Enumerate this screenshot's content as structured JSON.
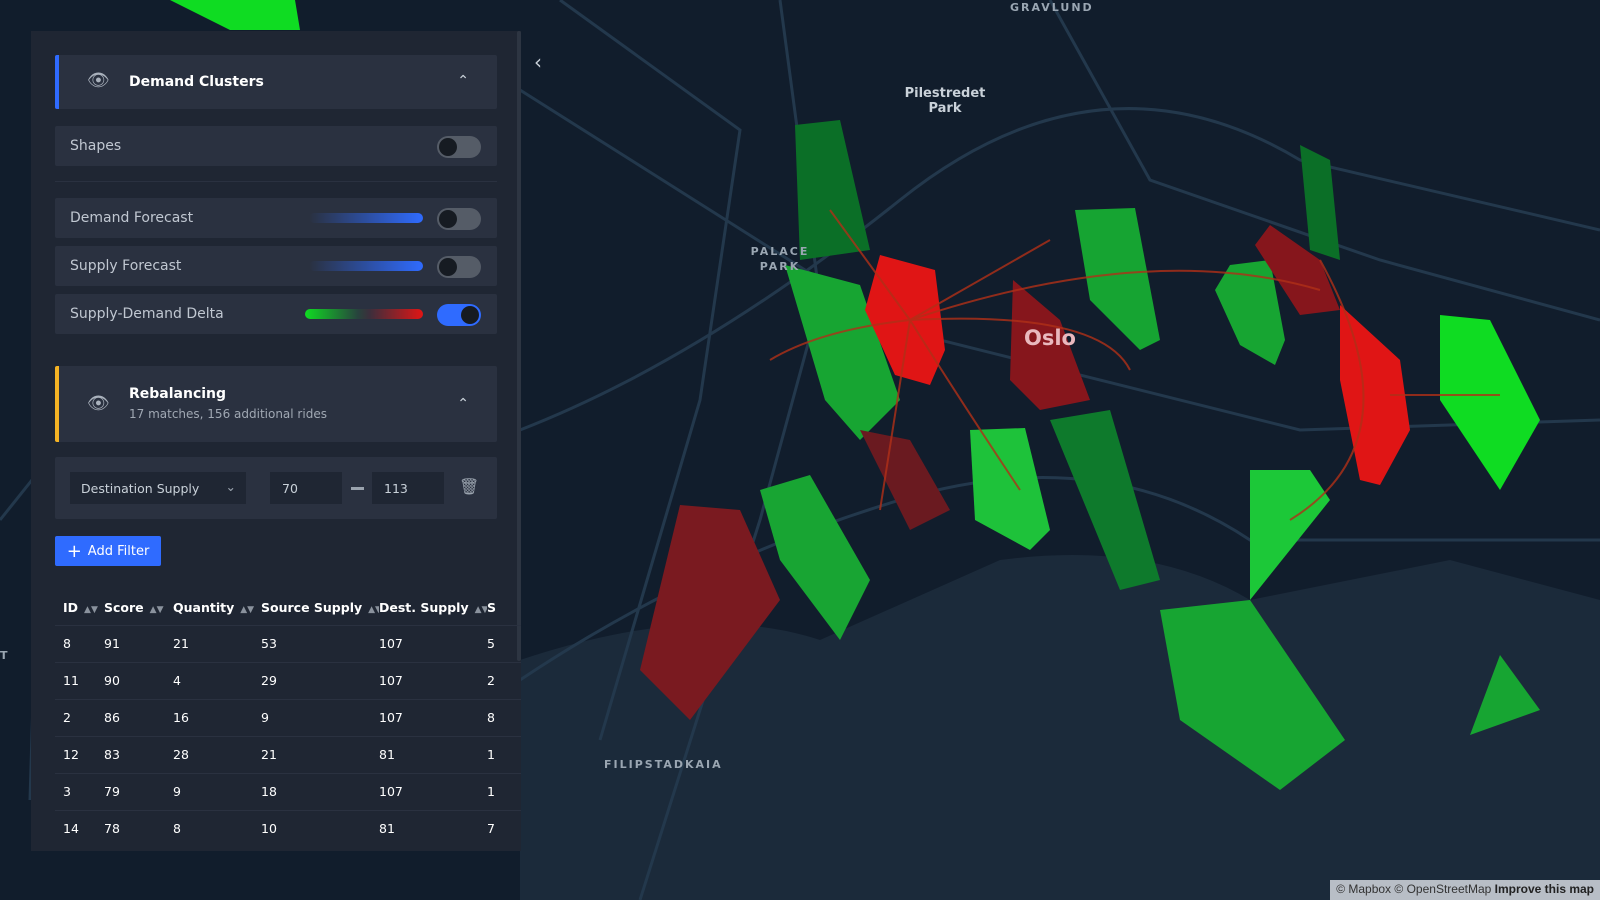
{
  "map": {
    "labels": {
      "gravlund": "GRAVLUND",
      "pilestredet": "Pilestredet Park",
      "palace": "PALACE PARK",
      "city": "Oslo",
      "filipstad": "FILIPSTADKAIA",
      "edge": "T"
    },
    "colors": {
      "surplus": "#0fdc22",
      "deficit": "#e01515",
      "background": "#0f1b29"
    },
    "attribution": {
      "mapbox": "© Mapbox",
      "osm": "© OpenStreetMap",
      "improve": "Improve this map"
    }
  },
  "panel": {
    "demand_clusters": {
      "title": "Demand Clusters",
      "accent": "#2f6bff",
      "icon": "eye-icon",
      "layers": [
        {
          "label": "Shapes",
          "on": false
        },
        {
          "label": "Demand Forecast",
          "on": false,
          "legend": "blue-gradient"
        },
        {
          "label": "Supply Forecast",
          "on": false,
          "legend": "blue-gradient"
        },
        {
          "label": "Supply-Demand Delta",
          "on": true,
          "legend": "green-red-gradient"
        }
      ]
    },
    "rebalancing": {
      "title": "Rebalancing",
      "subtitle": "17 matches, 156 additional rides",
      "accent": "#f5b324",
      "filter": {
        "field": "Destination Supply",
        "min": "70",
        "max": "113"
      },
      "add_filter_label": "Add Filter",
      "table": {
        "columns": [
          "ID",
          "Score",
          "Quantity",
          "Source Supply",
          "Dest. Supply",
          "S"
        ],
        "rows": [
          [
            "8",
            "91",
            "21",
            "53",
            "107",
            "5"
          ],
          [
            "11",
            "90",
            "4",
            "29",
            "107",
            "2"
          ],
          [
            "2",
            "86",
            "16",
            "9",
            "107",
            "8"
          ],
          [
            "12",
            "83",
            "28",
            "21",
            "81",
            "1"
          ],
          [
            "3",
            "79",
            "9",
            "18",
            "107",
            "1"
          ],
          [
            "14",
            "78",
            "8",
            "10",
            "81",
            "7"
          ]
        ]
      }
    }
  }
}
